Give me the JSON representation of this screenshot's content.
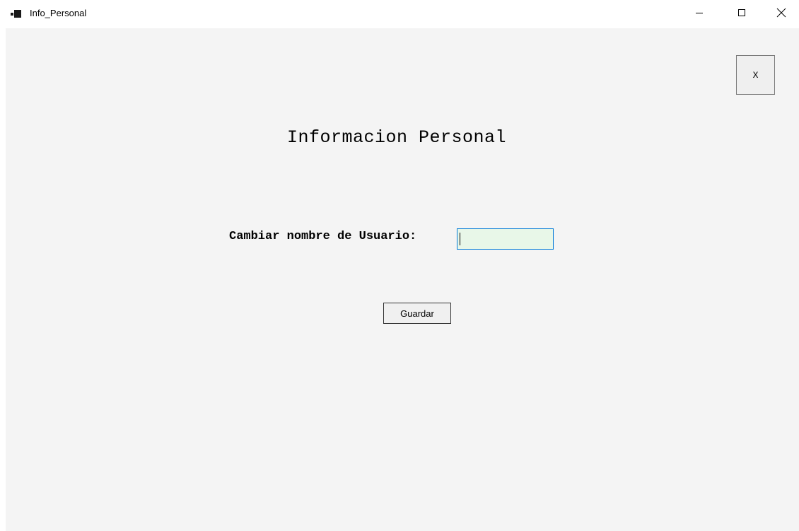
{
  "window": {
    "title": "Info_Personal",
    "icon": "app-window-icon",
    "controls": {
      "minimize_icon": "minimize-icon",
      "maximize_icon": "maximize-icon",
      "close_icon": "close-icon"
    }
  },
  "form": {
    "close_button_label": "X",
    "heading": "Informacion Personal",
    "username_label": "Cambiar nombre de Usuario:",
    "username_value": "",
    "save_button_label": "Guardar"
  },
  "colors": {
    "client_background": "#f4f4f4",
    "input_focus_border": "#0078d7",
    "input_background": "#e8f7e8"
  }
}
